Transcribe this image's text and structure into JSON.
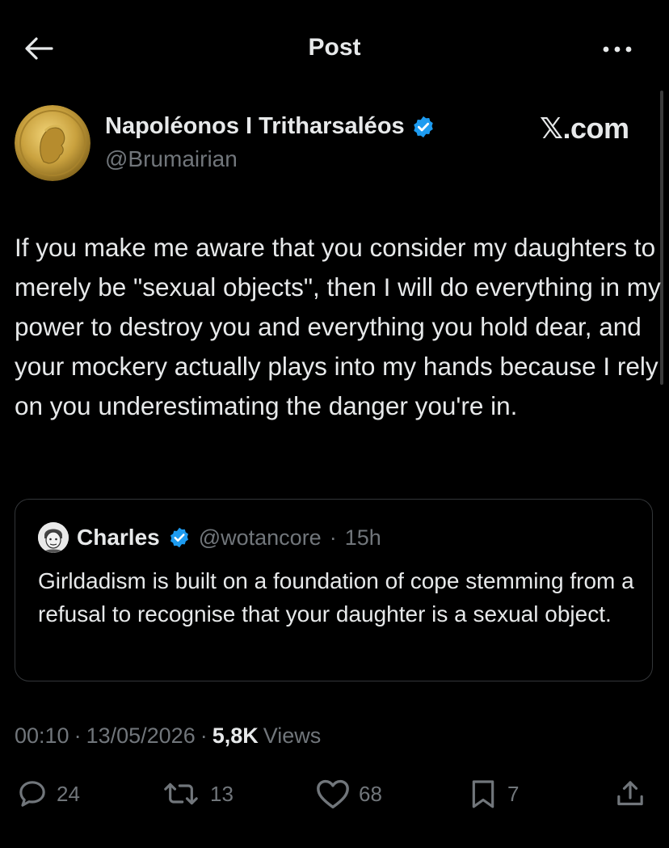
{
  "header": {
    "title": "Post",
    "back_icon": "back-arrow-icon",
    "more_icon": "more-dots-icon"
  },
  "author": {
    "name": "Napoléonos I Tritharsaléos",
    "handle": "@Brumairian",
    "verified": true,
    "avatar": "gold-coin-napoleon-avatar"
  },
  "watermark": "𝕏.com",
  "tweet": {
    "text": "If you make me aware that you consider my daughters to merely be \"sexual objects\", then I will do everything in my power to destroy you and everything you hold dear, and your mockery actually plays into my hands because I rely on you underestimating the danger you're in."
  },
  "quote": {
    "name": "Charles",
    "handle": "@wotancore",
    "separator": "·",
    "time": "15h",
    "verified": true,
    "text": "Girldadism is built on a foundation of cope stemming from a refusal to recognise that your daughter is a sexual object."
  },
  "meta": {
    "time": "00:10",
    "sep1": "·",
    "date": "13/05/2026",
    "sep2": "·",
    "views_count": "5,8K",
    "views_label": "Views"
  },
  "actions": {
    "replies": "24",
    "reposts": "13",
    "likes": "68",
    "bookmarks": "7"
  },
  "colors": {
    "background": "#000000",
    "text": "#e7e9ea",
    "muted": "#71767b",
    "verified": "#1d9bf0",
    "border": "#333639"
  }
}
